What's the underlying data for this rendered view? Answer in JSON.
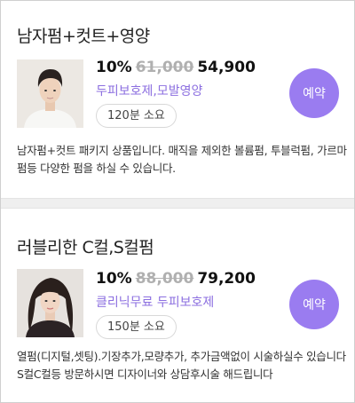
{
  "items": [
    {
      "title": "남자펌+컷트+영양",
      "discount": "10%",
      "original_price": "61,000",
      "sale_price": "54,900",
      "tags": "두피보호제,모발영양",
      "duration": "120분 소요",
      "book_label": "예약",
      "description": "남자펌+컷트 패키지 상품입니다. 매직을 제외한 볼륨펌, 투블럭펌, 가르마펌등 다양한 펌을 하실 수 있습니다."
    },
    {
      "title": "러블리한 C컬,S컬펌",
      "discount": "10%",
      "original_price": "88,000",
      "sale_price": "79,200",
      "tags": "클리닉무료 두피보호제",
      "duration": "150분 소요",
      "book_label": "예약",
      "description": "열펌(디지털,셋팅).기장추가,모량추가, 추가금액없이 시술하실수 있습니다 S컬C컬등 방문하시면 디자이너와 상담후시술 해드립니다"
    }
  ],
  "colors": {
    "accent": "#9a7cf0",
    "tag_text": "#8c6fe0",
    "strike": "#b0b0b0",
    "separator": "#efefef"
  }
}
